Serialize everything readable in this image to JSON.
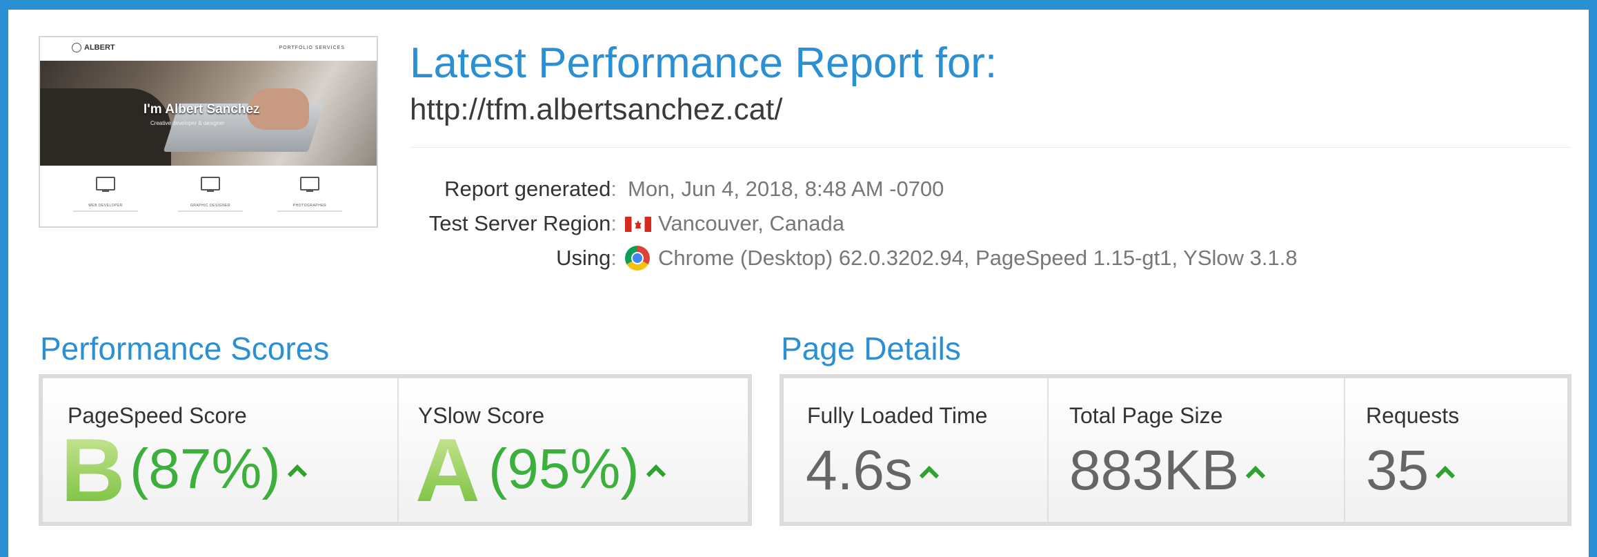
{
  "thumbnail": {
    "logo": "ALBERT",
    "nav": "PORTFOLIO   SERVICES",
    "hero_title": "I'm Albert Sanchez",
    "hero_subtitle": "Creative developer & designer",
    "services": [
      "WEB DEVELOPER",
      "GRAPHIC DESIGNER",
      "PHOTOGRAPHER"
    ]
  },
  "header": {
    "title": "Latest Performance Report for:",
    "url": "http://tfm.albertsanchez.cat/"
  },
  "meta": {
    "report_generated_label": "Report generated",
    "report_generated_value": "Mon, Jun 4, 2018, 8:48 AM -0700",
    "region_label": "Test Server Region",
    "region_value": "Vancouver, Canada",
    "using_label": "Using",
    "using_value": "Chrome (Desktop) 62.0.3202.94, PageSpeed 1.15-gt1, YSlow 3.1.8",
    "colon": ":"
  },
  "performance_scores": {
    "title": "Performance Scores",
    "pagespeed": {
      "label": "PageSpeed Score",
      "grade": "B",
      "percent": "(87%)",
      "value": 87
    },
    "yslow": {
      "label": "YSlow Score",
      "grade": "A",
      "percent": "(95%)",
      "value": 95
    }
  },
  "page_details": {
    "title": "Page Details",
    "fully_loaded": {
      "label": "Fully Loaded Time",
      "value": "4.6s"
    },
    "page_size": {
      "label": "Total Page Size",
      "value": "883KB"
    },
    "requests": {
      "label": "Requests",
      "value": "35"
    }
  },
  "colors": {
    "brand_blue": "#2b8fd4",
    "score_green": "#3caf3c",
    "caret_green": "#2ea12e"
  },
  "icons": [
    "canada-flag-icon",
    "chrome-icon",
    "monitor-icon",
    "caret-up-icon"
  ]
}
